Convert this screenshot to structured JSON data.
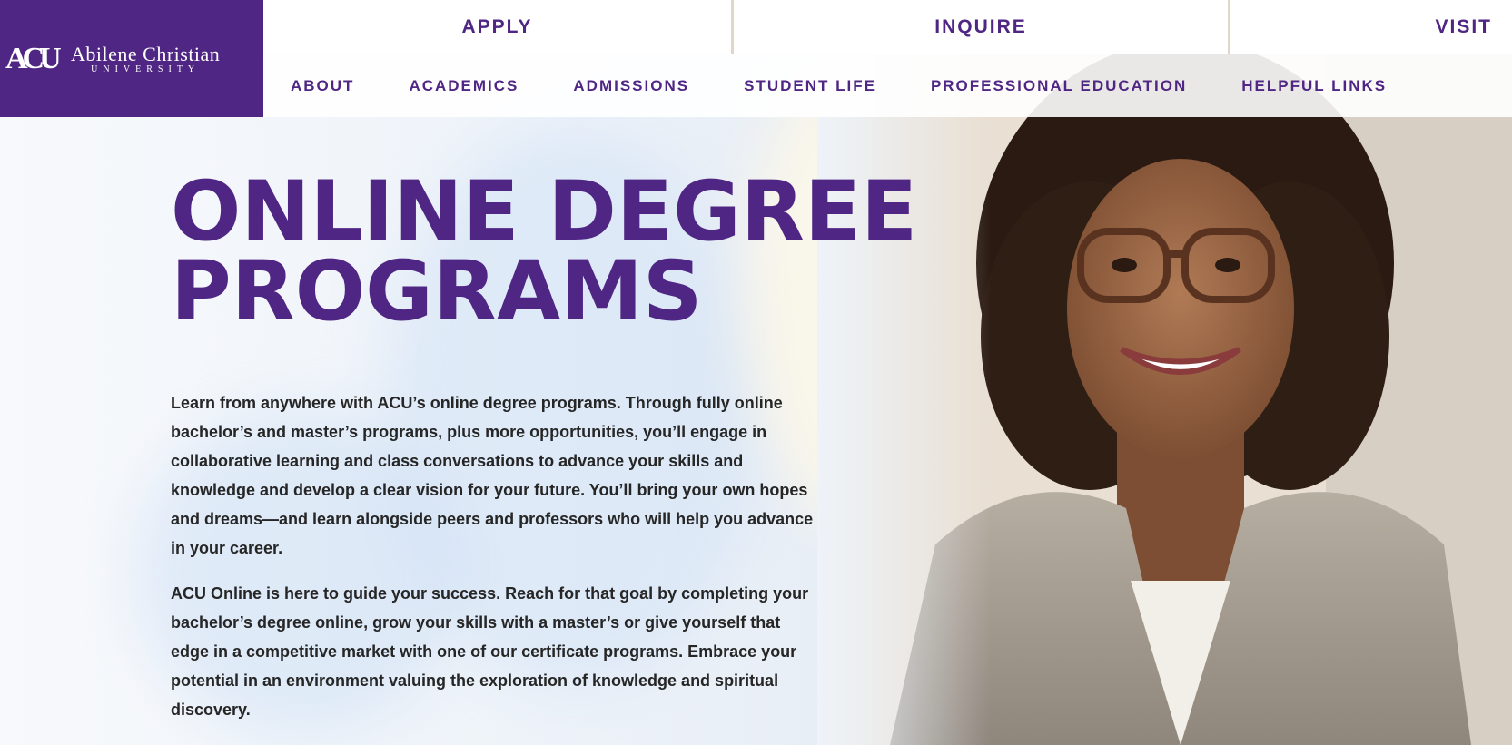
{
  "colors": {
    "brand_purple": "#4f2683",
    "body_text": "#262626",
    "header_bg": "#ffffff"
  },
  "logo": {
    "mark": "ACU",
    "name": "Abilene Christian",
    "sub": "UNIVERSITY"
  },
  "top_bar": {
    "apply": "APPLY",
    "inquire": "INQUIRE",
    "visit": "VISIT"
  },
  "nav": {
    "items": [
      {
        "label": "ABOUT"
      },
      {
        "label": "ACADEMICS"
      },
      {
        "label": "ADMISSIONS"
      },
      {
        "label": "STUDENT LIFE"
      },
      {
        "label": "PROFESSIONAL EDUCATION"
      },
      {
        "label": "HELPFUL LINKS"
      }
    ]
  },
  "hero": {
    "title_line1": "ONLINE DEGREE",
    "title_line2": "PROGRAMS",
    "paragraph1": "Learn from anywhere with ACU’s online degree programs. Through fully online bachelor’s and master’s programs, plus more opportunities, you’ll engage in collaborative learning and class conversations to advance your skills and knowledge and develop a clear vision for your future. You’ll bring your own hopes and dreams—and learn alongside peers and professors who will help you advance in your career.",
    "paragraph2": "ACU Online is here to guide your success. Reach for that goal by completing your bachelor’s degree online, grow your skills with a master’s or give yourself that edge in a competitive market with one of our certificate programs. Embrace your potential in an environment valuing the exploration of knowledge and spiritual discovery."
  }
}
